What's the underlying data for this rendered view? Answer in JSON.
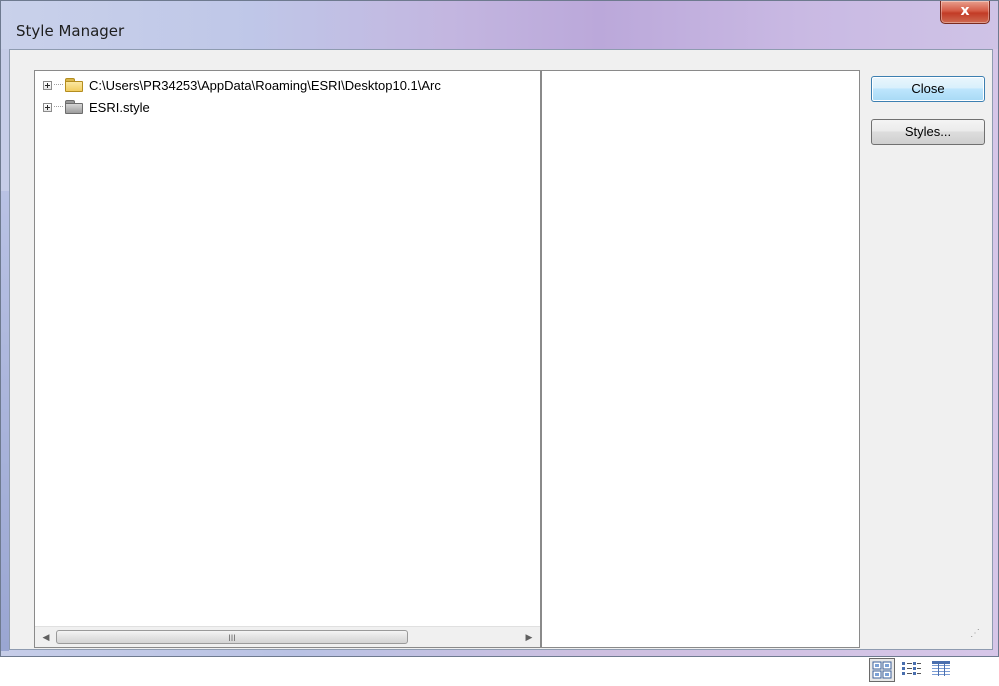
{
  "window": {
    "title": "Style Manager",
    "close_glyph": "x"
  },
  "tree": {
    "items": [
      {
        "label": "C:\\Users\\PR34253\\AppData\\Roaming\\ESRI\\Desktop10.1\\Arc",
        "icon": "folder-icon"
      },
      {
        "label": "ESRI.style",
        "icon": "style-folder-icon"
      }
    ]
  },
  "scrollbar": {
    "grip": "III",
    "left_arrow": "◀",
    "right_arrow": "▶"
  },
  "buttons": {
    "close_label": "Close",
    "styles_label": "Styles..."
  },
  "view_modes": [
    {
      "name": "large-icons",
      "selected": true
    },
    {
      "name": "list",
      "selected": false
    },
    {
      "name": "details",
      "selected": false
    }
  ],
  "colors": {
    "title_gradient_mid": "#bba8da",
    "close_red": "#c23b26",
    "default_button_border": "#3c7fb1"
  }
}
